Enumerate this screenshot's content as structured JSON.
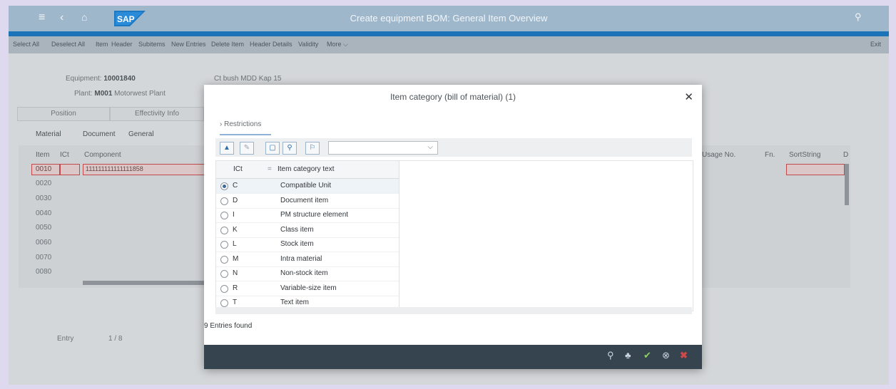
{
  "window": {
    "title": "Create equipment BOM: General Item Overview",
    "brand_logo": "SAP"
  },
  "shell_icons": [
    "menu-icon",
    "back-icon",
    "home-icon",
    "search-icon"
  ],
  "toolbar": {
    "items": [
      "Select All",
      "Deselect All",
      "Item",
      "Header",
      "Subitems",
      "New Entries",
      "Delete Item",
      "Header Details",
      "Validity",
      "More ⌵"
    ],
    "exit": "Exit"
  },
  "header": {
    "equipment_label": "Equipment:",
    "equipment_value": "10001840",
    "description": "Ct bush MDD Kap 15",
    "plant_label": "Plant:",
    "plant_code": "M001",
    "plant_name": "Motorwest Plant"
  },
  "background_tabs": {
    "position": "Position",
    "effectivity": "Effectivity Info"
  },
  "sub_tabs": [
    "Material",
    "Document",
    "General"
  ],
  "table": {
    "columns": [
      "Item",
      "ICt",
      "Component",
      "Usage No.",
      "Fn.",
      "SortString",
      "D"
    ],
    "items": [
      "0010",
      "0020",
      "0030",
      "0040",
      "0050",
      "0060",
      "0070",
      "0080"
    ],
    "component_value": "111111111111111858"
  },
  "entry": {
    "label": "Entry",
    "value": "1 / 8"
  },
  "dialog": {
    "title": "Item category (bill of material) (1)",
    "close": "✕",
    "restrictions": "Restrictions",
    "restrictions_chevron": "›",
    "col_code": "ICt",
    "col_sort_marker": "=",
    "col_text": "Item category text",
    "entries_found": "9 Entries found",
    "selected_index": 0,
    "rows": [
      {
        "code": "C",
        "text": "Compatible Unit"
      },
      {
        "code": "D",
        "text": "Document item"
      },
      {
        "code": "I",
        "text": "PM structure element"
      },
      {
        "code": "K",
        "text": "Class item"
      },
      {
        "code": "L",
        "text": "Stock item"
      },
      {
        "code": "M",
        "text": "Intra material"
      },
      {
        "code": "N",
        "text": "Non-stock item"
      },
      {
        "code": "R",
        "text": "Variable-size item"
      },
      {
        "code": "T",
        "text": "Text item"
      }
    ],
    "select_chevron": "⌵",
    "footer_icons": [
      "search-icon",
      "hierarchy-icon",
      "check-icon",
      "reset-icon",
      "cancel-icon"
    ]
  },
  "colors": {
    "shell": "#9fb7cb",
    "shell_accent": "#1c73b8",
    "dialog_footer": "#36444f",
    "cancel": "#d04848"
  }
}
